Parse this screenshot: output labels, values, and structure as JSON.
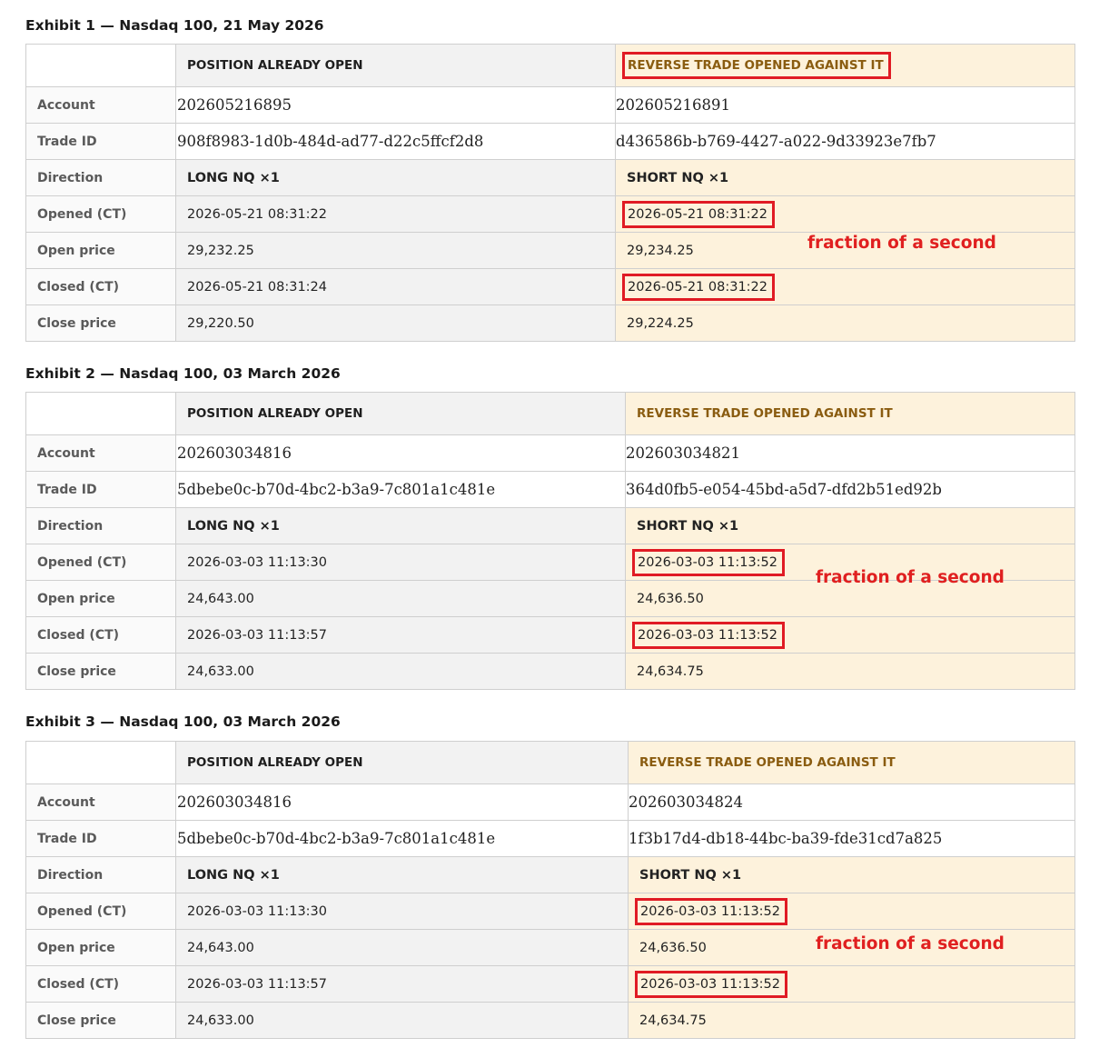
{
  "col_headers": {
    "open": "POSITION ALREADY OPEN",
    "reverse": "REVERSE TRADE OPENED AGAINST IT"
  },
  "row_labels": {
    "account": "Account",
    "trade_id": "Trade ID",
    "direction": "Direction",
    "opened": "Opened (CT)",
    "open_price": "Open price",
    "closed": "Closed (CT)",
    "close_price": "Close price"
  },
  "annotation_text": "fraction of a second",
  "highlight_color": "#e01b24",
  "exhibits": [
    {
      "title": "Exhibit 1 — Nasdaq 100, 21 May 2026",
      "open": {
        "account": "202605216895",
        "trade_id": "908f8983-1d0b-484d-ad77-d22c5ffcf2d8",
        "direction": "LONG NQ ×1",
        "opened": "2026-05-21 08:31:22",
        "open_price": "29,232.25",
        "closed": "2026-05-21 08:31:24",
        "close_price": "29,220.50"
      },
      "reverse": {
        "account": "202605216891",
        "trade_id": "d436586b-b769-4427-a022-9d33923e7fb7",
        "direction": "SHORT NQ ×1",
        "opened": "2026-05-21 08:31:22",
        "open_price": "29,234.25",
        "closed": "2026-05-21 08:31:22",
        "close_price": "29,224.25"
      }
    },
    {
      "title": "Exhibit 2 — Nasdaq 100, 03 March 2026",
      "open": {
        "account": "202603034816",
        "trade_id": "5dbebe0c-b70d-4bc2-b3a9-7c801a1c481e",
        "direction": "LONG NQ ×1",
        "opened": "2026-03-03 11:13:30",
        "open_price": "24,643.00",
        "closed": "2026-03-03 11:13:57",
        "close_price": "24,633.00"
      },
      "reverse": {
        "account": "202603034821",
        "trade_id": "364d0fb5-e054-45bd-a5d7-dfd2b51ed92b",
        "direction": "SHORT NQ ×1",
        "opened": "2026-03-03 11:13:52",
        "open_price": "24,636.50",
        "closed": "2026-03-03 11:13:52",
        "close_price": "24,634.75"
      }
    },
    {
      "title": "Exhibit 3 — Nasdaq 100, 03 March 2026",
      "open": {
        "account": "202603034816",
        "trade_id": "5dbebe0c-b70d-4bc2-b3a9-7c801a1c481e",
        "direction": "LONG NQ ×1",
        "opened": "2026-03-03 11:13:30",
        "open_price": "24,643.00",
        "closed": "2026-03-03 11:13:57",
        "close_price": "24,633.00"
      },
      "reverse": {
        "account": "202603034824",
        "trade_id": "1f3b17d4-db18-44bc-ba39-fde31cd7a825",
        "direction": "SHORT NQ ×1",
        "opened": "2026-03-03 11:13:52",
        "open_price": "24,636.50",
        "closed": "2026-03-03 11:13:52",
        "close_price": "24,634.75"
      }
    }
  ]
}
